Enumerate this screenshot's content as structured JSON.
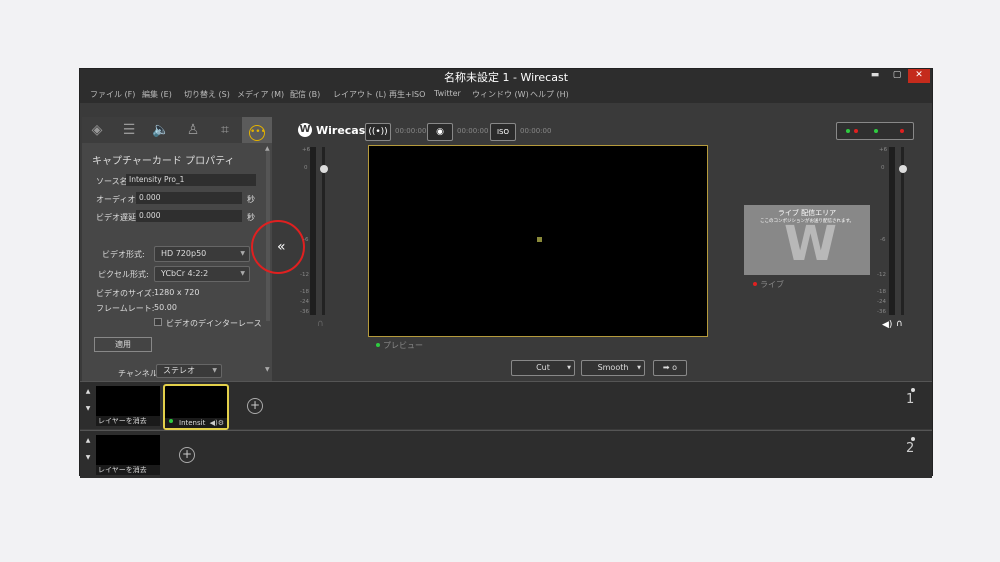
{
  "window": {
    "title": "名称未設定 1 - Wirecast",
    "min_icon": "minimize-icon",
    "max_icon": "maximize-icon",
    "close_icon": "close-icon"
  },
  "menu": [
    "ファイル (F)",
    "編集 (E)",
    "切り替え (S)",
    "メディア (M)",
    "配信 (B)",
    "レイアウト (L)",
    "再生+ISO",
    "Twitter",
    "ウィンドウ (W)",
    "ヘルプ (H)"
  ],
  "left_tabs": [
    "layers-icon",
    "sliders-icon",
    "speaker-icon",
    "person-icon",
    "crop-icon",
    "more-icon"
  ],
  "panel": {
    "title": "キャプチャーカード プロパティ",
    "source_label": "ソース名",
    "source_value": "Intensity Pro_1",
    "audio_delay_label": "オーディオ遅延:",
    "audio_delay_value": "0.000",
    "video_delay_label": "ビデオ遅延:",
    "video_delay_value": "0.000",
    "sec_unit": "秒",
    "video_format_label": "ビデオ形式:",
    "video_format_value": "HD 720p50",
    "pixel_format_label": "ピクセル形式:",
    "pixel_format_value": "YCbCr 4:2:2",
    "video_size_label": "ビデオのサイズ:",
    "video_size_value": "1280 x 720",
    "frame_rate_label": "フレームレート:",
    "frame_rate_value": "50.00",
    "deinterlace_label": "ビデオのデインターレース",
    "apply_label": "適用",
    "channel_label": "チャンネル:",
    "channel_value": "ステレオ"
  },
  "collapse_glyph": "«",
  "toolbar": {
    "logo": "Wirecast",
    "timer1": "00:00:00",
    "timer2": "00:00:00",
    "timer3": "00:00:00",
    "iso_label": "ISO"
  },
  "preview_label": "プレビュー",
  "live": {
    "title": "ライブ 配信エリア",
    "subtitle": "ここのコンポジションがお送り配信されます。",
    "label": "ライブ"
  },
  "transitions": {
    "cut": "Cut",
    "smooth": "Smooth",
    "go": "➡ o"
  },
  "db_ticks": [
    "+6",
    "0",
    "-6",
    "-12",
    "-18",
    "-24",
    "-36"
  ],
  "layers": [
    {
      "number": "1",
      "shots": [
        {
          "caption": "レイヤーを消去"
        },
        {
          "caption": "Intensit"
        }
      ]
    },
    {
      "number": "2",
      "shots": [
        {
          "caption": "レイヤーを消去"
        }
      ]
    }
  ],
  "colors": {
    "accent": "#e3b200",
    "live_red": "#e02020",
    "preview_green": "#2ecc40"
  }
}
